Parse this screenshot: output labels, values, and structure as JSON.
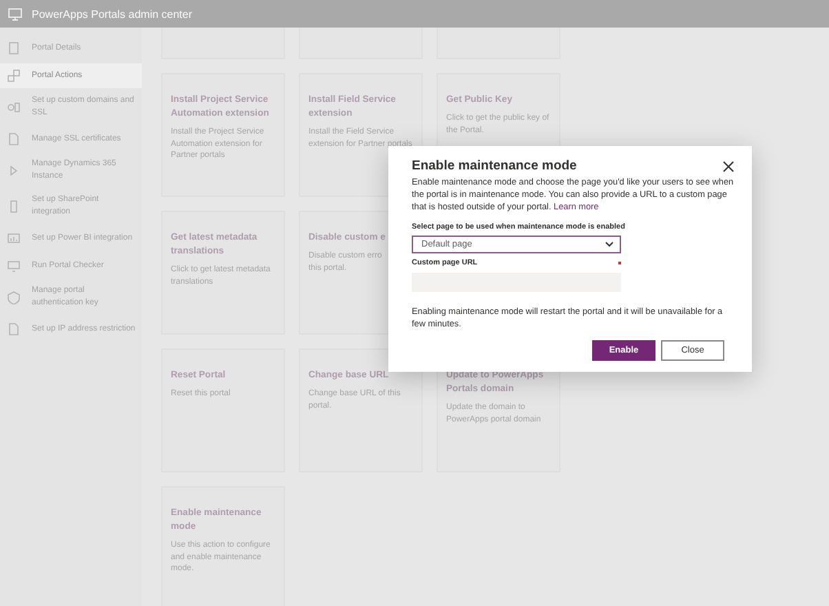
{
  "header": {
    "title": "PowerApps Portals admin center"
  },
  "sidebar": {
    "items": [
      {
        "label": "Portal Details",
        "selected": false
      },
      {
        "label": "Portal Actions",
        "selected": true
      },
      {
        "label": "Set up custom domains and SSL",
        "selected": false
      },
      {
        "label": "Manage SSL certificates",
        "selected": false
      },
      {
        "label": "Manage Dynamics 365 Instance",
        "selected": false
      },
      {
        "label": "Set up SharePoint integration",
        "selected": false
      },
      {
        "label": "Set up Power BI integration",
        "selected": false
      },
      {
        "label": "Run Portal Checker",
        "selected": false
      },
      {
        "label": "Manage portal authentication key",
        "selected": false
      },
      {
        "label": "Set up IP address restriction",
        "selected": false
      }
    ]
  },
  "cards": [
    {
      "title": "Install Project Service Automation extension",
      "description": "Install the Project Service Automation extension for Partner portals"
    },
    {
      "title": "Install Field Service extension",
      "description": "Install the Field Service extension for Partner portals"
    },
    {
      "title": "Get Public Key",
      "description": "Click to get the public key of the Portal."
    },
    {
      "title": "Get latest metadata translations",
      "description": "Click to get latest metadata translations"
    },
    {
      "title": "Disable custom e",
      "description": "Disable custom erro this portal."
    },
    {
      "title": "Reset Portal",
      "description": "Reset this portal"
    },
    {
      "title": "Change base URL",
      "description": "Change base URL of this portal."
    },
    {
      "title": "Update to PowerApps Portals domain",
      "description": "Update the domain to PowerApps portal domain"
    },
    {
      "title": "Enable maintenance mode",
      "description": "Use this action to configure and enable maintenance mode."
    }
  ],
  "dialog": {
    "title": "Enable maintenance mode",
    "description": "Enable maintenance mode and choose the page you'd like your users to see when the portal is in maintenance mode. You can also provide a URL to a custom page that is hosted outside of your portal.",
    "link": "Learn more",
    "select": {
      "label": "Select page to be used when maintenance mode is enabled",
      "value": "Default page"
    },
    "url_field": {
      "label": "Custom page URL",
      "required": true,
      "disabled": true
    },
    "note": "Enabling maintenance mode will restart the portal and it will be unavailable for a few minutes.",
    "buttons": [
      {
        "label": "Enable",
        "kind": "primary"
      },
      {
        "label": "Close",
        "kind": "secondary"
      }
    ]
  }
}
